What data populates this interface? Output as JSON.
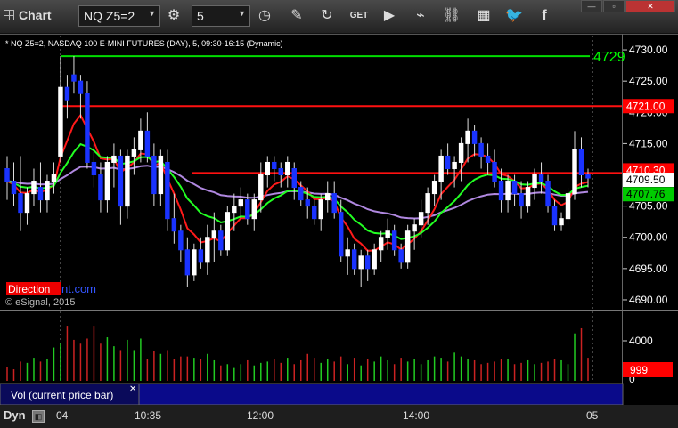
{
  "toolbar": {
    "title": "Chart",
    "symbol": "NQ Z5=2",
    "interval": "5",
    "icons": [
      "gear-icon",
      "clock-icon",
      "pencil-icon",
      "refresh-icon",
      "get-icon",
      "play-icon",
      "chart-icon",
      "link-icon",
      "grid-icon",
      "twitter-icon",
      "facebook-icon"
    ],
    "window_buttons": [
      "minimize",
      "maximize",
      "close"
    ]
  },
  "chart": {
    "header": "* NQ Z5=2, NASDAQ 100 E-MINI FUTURES (DAY), 5, 09:30-16:15 (Dynamic)",
    "copyright": "© eSignal, 2015",
    "watermark_red": "Direction",
    "watermark_blue": "nt.com",
    "level_label": "4729",
    "y_ticks": [
      "4730.00",
      "4725.00",
      "4720.00",
      "4715.00",
      "4710.00",
      "4705.00",
      "4700.00",
      "4695.00",
      "4690.00"
    ],
    "price_tags": [
      {
        "text": "4721.00",
        "bg": "#ff0000",
        "fg": "#ffffff"
      },
      {
        "text": "4710.30",
        "bg": "#ff0000",
        "fg": "#ffffff"
      },
      {
        "text": "4709.50",
        "bg": "#ffffff",
        "fg": "#000000"
      },
      {
        "text": "4707.76",
        "bg": "#00cc00",
        "fg": "#000000"
      }
    ],
    "volume_ticks": [
      "4000",
      "0"
    ],
    "volume_tag": "999",
    "volume_label": "Vol (current price bar)",
    "x_labels": [
      "04",
      "10:35",
      "12:00",
      "14:00",
      "05"
    ]
  },
  "footer": {
    "mode": "Dyn"
  },
  "chart_data": {
    "type": "candlestick",
    "ylim": [
      4689,
      4732
    ],
    "candles": [
      [
        4711,
        4713,
        4706,
        4709
      ],
      [
        4709,
        4712,
        4705,
        4707
      ],
      [
        4707,
        4713,
        4701,
        4704
      ],
      [
        4704,
        4708,
        4702,
        4707
      ],
      [
        4707,
        4711,
        4705,
        4709
      ],
      [
        4708,
        4712,
        4704,
        4706
      ],
      [
        4706,
        4710,
        4704,
        4709
      ],
      [
        4709,
        4712,
        4707,
        4710
      ],
      [
        4713,
        4729,
        4712,
        4724
      ],
      [
        4724,
        4726,
        4719,
        4722
      ],
      [
        4726,
        4729,
        4723,
        4725
      ],
      [
        4725,
        4726,
        4719,
        4723
      ],
      [
        4723,
        4725,
        4711,
        4712
      ],
      [
        4712,
        4715,
        4708,
        4710
      ],
      [
        4710,
        4712,
        4704,
        4706
      ],
      [
        4706,
        4713,
        4704,
        4712
      ],
      [
        4712,
        4715,
        4708,
        4713
      ],
      [
        4713,
        4714,
        4702,
        4705
      ],
      [
        4705,
        4714,
        4703,
        4713
      ],
      [
        4713,
        4716,
        4710,
        4714
      ],
      [
        4714,
        4719,
        4712,
        4717
      ],
      [
        4717,
        4720,
        4712,
        4713
      ],
      [
        4713,
        4715,
        4705,
        4707
      ],
      [
        4707,
        4714,
        4705,
        4713
      ],
      [
        4712,
        4714,
        4701,
        4703
      ],
      [
        4703,
        4707,
        4699,
        4701
      ],
      [
        4701,
        4702,
        4696,
        4698
      ],
      [
        4698,
        4700,
        4692,
        4694
      ],
      [
        4694,
        4699,
        4693,
        4698
      ],
      [
        4698,
        4700,
        4695,
        4696
      ],
      [
        4696,
        4702,
        4694,
        4700
      ],
      [
        4700,
        4704,
        4696,
        4701
      ],
      [
        4701,
        4702,
        4697,
        4698
      ],
      [
        4698,
        4705,
        4697,
        4704
      ],
      [
        4704,
        4707,
        4701,
        4705
      ],
      [
        4705,
        4708,
        4703,
        4706
      ],
      [
        4706,
        4707,
        4702,
        4703
      ],
      [
        4703,
        4707,
        4701,
        4706
      ],
      [
        4706,
        4712,
        4704,
        4710
      ],
      [
        4710,
        4713,
        4708,
        4712
      ],
      [
        4712,
        4713,
        4709,
        4711
      ],
      [
        4711,
        4712,
        4708,
        4710
      ],
      [
        4710,
        4713,
        4708,
        4712
      ],
      [
        4711,
        4712,
        4706,
        4708
      ],
      [
        4708,
        4709,
        4705,
        4706
      ],
      [
        4706,
        4708,
        4703,
        4705
      ],
      [
        4705,
        4706,
        4702,
        4703
      ],
      [
        4703,
        4707,
        4701,
        4706
      ],
      [
        4706,
        4709,
        4704,
        4707
      ],
      [
        4707,
        4709,
        4703,
        4704
      ],
      [
        4704,
        4706,
        4696,
        4697
      ],
      [
        4697,
        4700,
        4694,
        4698
      ],
      [
        4698,
        4699,
        4694,
        4695
      ],
      [
        4695,
        4698,
        4692,
        4697
      ],
      [
        4697,
        4698,
        4693,
        4695
      ],
      [
        4695,
        4699,
        4694,
        4698
      ],
      [
        4698,
        4701,
        4696,
        4700
      ],
      [
        4700,
        4703,
        4698,
        4701
      ],
      [
        4701,
        4702,
        4697,
        4698
      ],
      [
        4698,
        4699,
        4695,
        4696
      ],
      [
        4696,
        4702,
        4695,
        4701
      ],
      [
        4701,
        4703,
        4698,
        4702
      ],
      [
        4702,
        4706,
        4700,
        4704
      ],
      [
        4704,
        4708,
        4702,
        4707
      ],
      [
        4707,
        4710,
        4705,
        4709
      ],
      [
        4709,
        4714,
        4706,
        4713
      ],
      [
        4713,
        4715,
        4710,
        4711
      ],
      [
        4711,
        4713,
        4708,
        4712
      ],
      [
        4712,
        4716,
        4709,
        4715
      ],
      [
        4715,
        4719,
        4712,
        4717
      ],
      [
        4717,
        4718,
        4713,
        4715
      ],
      [
        4715,
        4716,
        4711,
        4713
      ],
      [
        4713,
        4715,
        4710,
        4712
      ],
      [
        4712,
        4714,
        4708,
        4709
      ],
      [
        4709,
        4711,
        4704,
        4706
      ],
      [
        4706,
        4710,
        4704,
        4709
      ],
      [
        4709,
        4710,
        4705,
        4707
      ],
      [
        4707,
        4709,
        4703,
        4705
      ],
      [
        4705,
        4709,
        4704,
        4708
      ],
      [
        4708,
        4711,
        4706,
        4710
      ],
      [
        4710,
        4712,
        4707,
        4709
      ],
      [
        4709,
        4710,
        4704,
        4705
      ],
      [
        4705,
        4706,
        4701,
        4702
      ],
      [
        4702,
        4704,
        4701,
        4703
      ],
      [
        4703,
        4708,
        4702,
        4707
      ],
      [
        4707,
        4717,
        4706,
        4714
      ],
      [
        4714,
        4716,
        4708,
        4710
      ],
      [
        4710,
        4711,
        4708,
        4709.5
      ]
    ],
    "volumes": [
      1100,
      900,
      1500,
      1400,
      1800,
      1500,
      1700,
      2600,
      2900,
      4300,
      3200,
      2900,
      3300,
      4300,
      2900,
      3400,
      2700,
      2400,
      3200,
      2400,
      3300,
      1700,
      2300,
      2100,
      2400,
      1700,
      1900,
      1900,
      1800,
      1700,
      2100,
      1600,
      1200,
      1300,
      1000,
      1300,
      1600,
      1200,
      1400,
      1500,
      1700,
      1400,
      1800,
      1300,
      1600,
      2100,
      1800,
      1400,
      1700,
      1500,
      1900,
      1300,
      1800,
      1200,
      1700,
      1500,
      1900,
      1600,
      1300,
      1800,
      1500,
      1700,
      1300,
      1600,
      1900,
      1800,
      1500,
      2200,
      1900,
      1700,
      1600,
      1300,
      1400,
      1500,
      1700,
      1700,
      1300,
      1400,
      1600,
      1300,
      1400,
      1500,
      1700,
      1600,
      1300,
      3700,
      4100,
      1800
    ],
    "lines": {
      "level_green": 4729,
      "level_red": 4721,
      "level_red2": 4710.3
    }
  }
}
